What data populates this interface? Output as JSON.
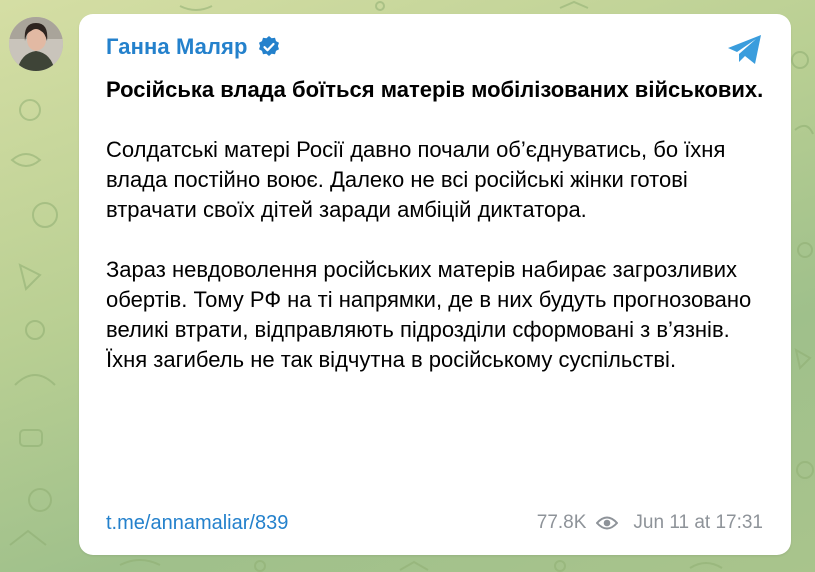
{
  "post": {
    "author": "Ганна Маляр",
    "headline": "Російська влада боїться матерів мобілізованих військових.",
    "paragraphs": [
      "Солдатські матері Росії давно почали об’єднуватись, бо їхня влада постійно воює. Далеко не всі російські жінки готові втрачати своїх дітей заради амбіцій диктатора.",
      "Зараз невдоволення російських матерів набирає загрозливих обертів. Тому РФ на ті напрямки, де в них будуть прогнозовано великі втрати, відправляють підрозділи сформовані з в’язнів. Їхня загибель не так відчутна в російському суспільстві."
    ],
    "link": "t.me/annamaliar/839",
    "views": "77.8K",
    "date": "Jun 11 at 17:31"
  },
  "icons": {
    "verified": "verified-badge-icon",
    "share": "telegram-share-icon",
    "views": "eye-icon"
  },
  "colors": {
    "accent": "#2481cc",
    "text": "#000000",
    "meta": "#8e9399",
    "card": "#ffffff"
  }
}
